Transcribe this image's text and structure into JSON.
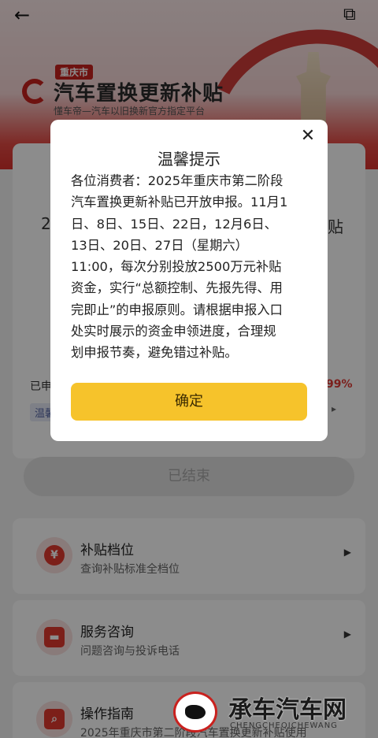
{
  "nav": {
    "back_icon": "arrow-left-icon",
    "edit_icon": "external-edit-icon"
  },
  "brand": {
    "city_badge": "重庆市",
    "title": "汽车置换更新补贴",
    "subtitle": "懂车帝—汽车以旧换新官方指定平台"
  },
  "background": {
    "peek_left": "2",
    "peek_right": "贴",
    "applied_label": "已申",
    "percent": "99%",
    "tag": "温馨",
    "ended_button": "已结束"
  },
  "menu": [
    {
      "title": "补贴档位",
      "desc": "查询补贴标准全档位",
      "icon": "yen-icon",
      "glyph": "¥"
    },
    {
      "title": "服务咨询",
      "desc": "问题咨询与投诉电话",
      "icon": "chat-icon",
      "glyph": "▬"
    },
    {
      "title": "操作指南",
      "desc": "2025年重庆市第二阶段汽车置换更新补贴使用",
      "icon": "search-doc-icon",
      "glyph": "⌕"
    }
  ],
  "dialog": {
    "title": "温馨提示",
    "close_label": "✕",
    "body_lines": [
      "各位消费者：2025年重庆市第二阶段",
      "汽车置换更新补贴已开放申报。11月1",
      "日、8日、15日、22日，12月6日、",
      "13日、20日、27日（星期六）",
      "11:00，每次分别投放2500万元补贴",
      "资金，实行“总额控制、先报先得、用",
      "完即止”的申报原则。请根据申报入口",
      "处实时展示的资金申领进度，合理规",
      "划申报节奏，避免错过补贴。"
    ],
    "confirm_label": "确定"
  },
  "watermark": {
    "title": "承车汽车网",
    "subtitle": "CHENGCHEQICHEWANG"
  },
  "colors": {
    "brand_red": "#c9211e",
    "confirm_yellow": "#f6c32b",
    "percent_red": "#e03a33"
  }
}
